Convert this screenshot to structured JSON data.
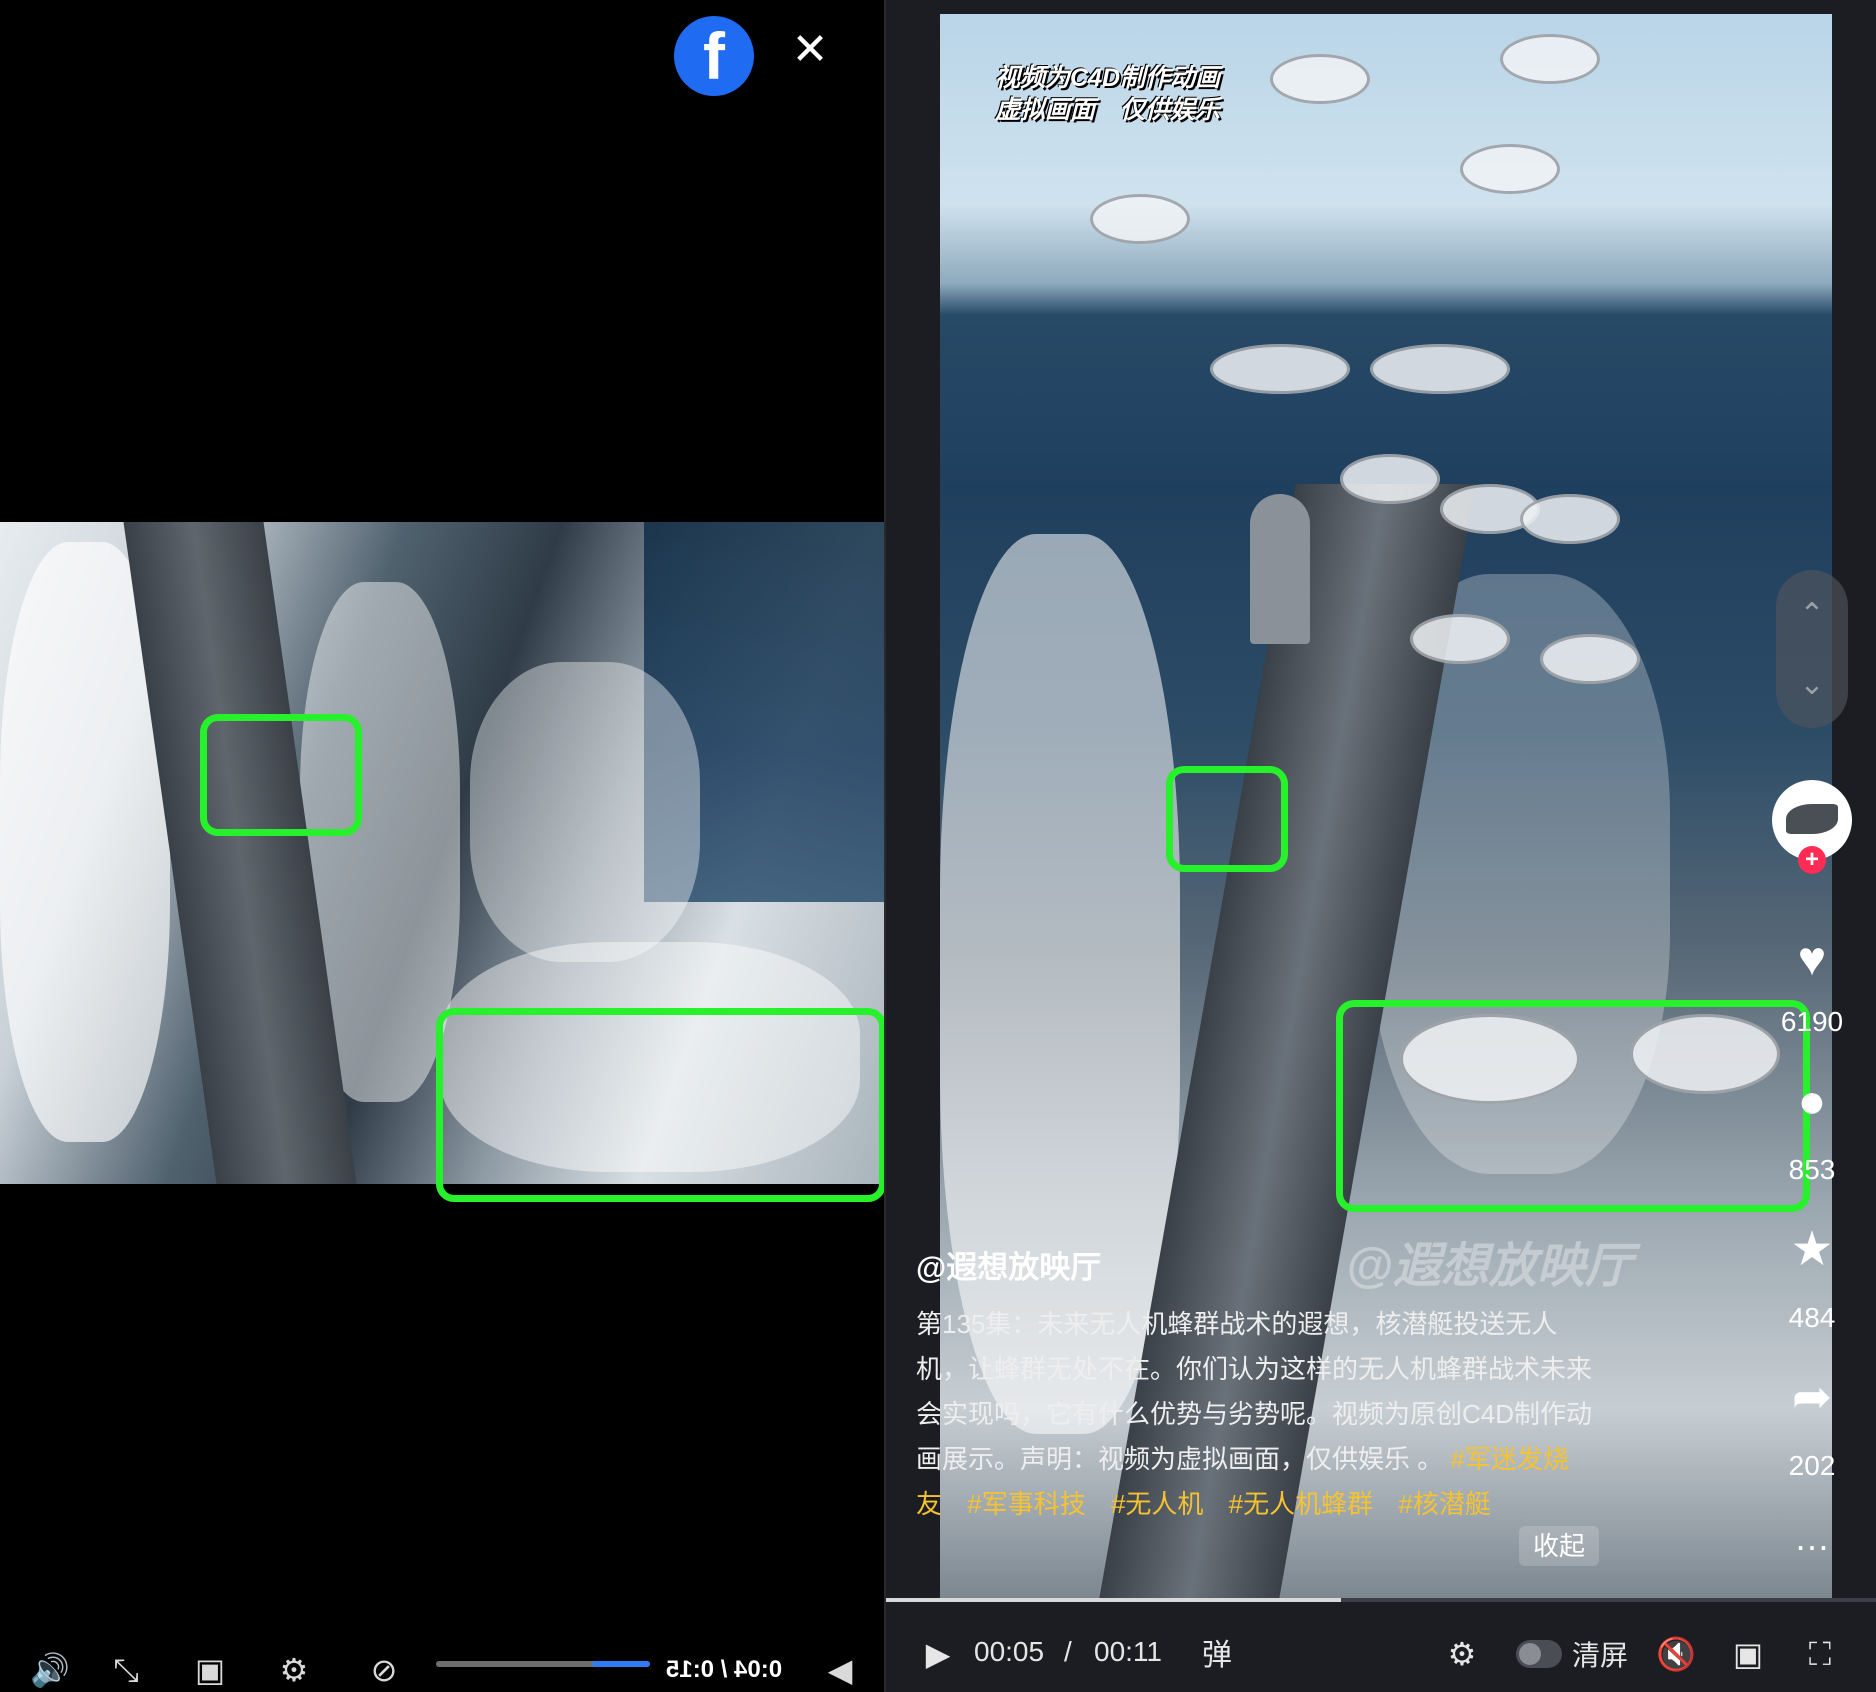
{
  "left_player": {
    "top_icons": [
      "facebook-logo-icon",
      "close-icon"
    ],
    "time_display": "0:04 / 0:15",
    "progress_fraction": 0.27,
    "controls": [
      "volume-icon",
      "fullscreen-icon",
      "pip-icon",
      "settings-icon",
      "captions-icon",
      "play-icon"
    ]
  },
  "right_player": {
    "caption_line1": "视频为C4D制作动画",
    "caption_line2": "虚拟画面　仅供娱乐",
    "watermark": "@遐想放映厅",
    "author": "@遐想放映厅",
    "description": "第135集：未来无人机蜂群战术的遐想，核潜艇投送无人机，让蜂群无处不在。你们认为这样的无人机蜂群战术未来会实现吗，它有什么优势与劣势呢。视频为原创C4D制作动画展示。声明：视频为虚拟画面，仅供娱乐 。",
    "tags": [
      "#军迷发烧友",
      "#军事科技",
      "#无人机",
      "#无人机蜂群",
      "#核潜艇"
    ],
    "collapse_label": "收起",
    "likes": "6190",
    "comments": "853",
    "favorites": "484",
    "shares": "202",
    "current_time": "00:05",
    "time_sep": "/",
    "total_time": "00:11",
    "danmaku_label": "弹",
    "clear_screen_label": "清屏",
    "progress_fraction": 0.46
  },
  "highlight_color": "#27f12a",
  "tag_color": "#f5c232"
}
